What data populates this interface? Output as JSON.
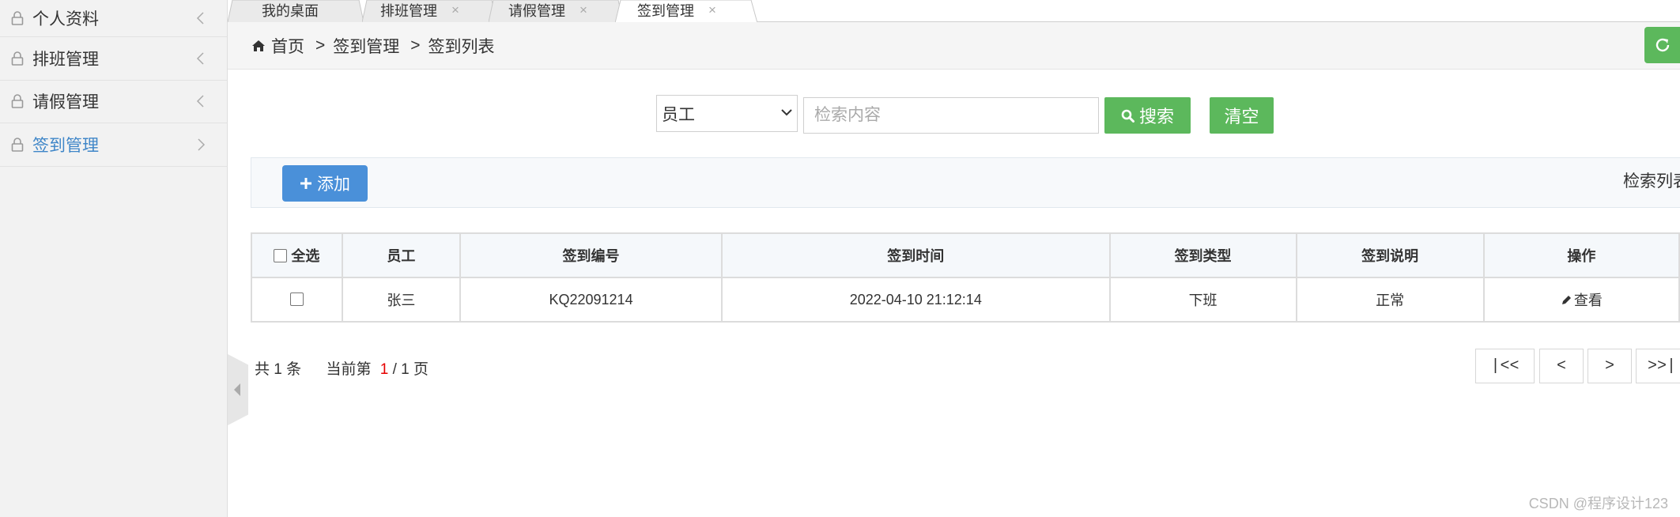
{
  "sidebar": {
    "items": [
      {
        "label": "个人资料",
        "active": false
      },
      {
        "label": "排班管理",
        "active": false
      },
      {
        "label": "请假管理",
        "active": false
      },
      {
        "label": "签到管理",
        "active": true
      }
    ]
  },
  "tabs": [
    {
      "label": "我的桌面",
      "closable": false,
      "active": false
    },
    {
      "label": "排班管理",
      "closable": true,
      "active": false
    },
    {
      "label": "请假管理",
      "closable": true,
      "active": false
    },
    {
      "label": "签到管理",
      "closable": true,
      "active": true
    }
  ],
  "tab_close_glyph": "×",
  "breadcrumb": {
    "home": "首页",
    "separator": ">",
    "level1": "签到管理",
    "level2": "签到列表"
  },
  "search": {
    "field_selected": "员工",
    "placeholder": "检索内容",
    "value": "",
    "search_label": "搜索",
    "clear_label": "清空"
  },
  "toolbar": {
    "add_label": "添加",
    "list_title": "检索列表"
  },
  "table": {
    "select_all_label": "全选",
    "headers": [
      "员工",
      "签到编号",
      "签到时间",
      "签到类型",
      "签到说明",
      "操作"
    ],
    "rows": [
      {
        "employee": "张三",
        "code": "KQ22091214",
        "time": "2022-04-10 21:12:14",
        "type": "下班",
        "note": "正常",
        "action": "查看"
      }
    ]
  },
  "pagination": {
    "total_prefix": "共",
    "total": "1",
    "total_suffix": "条",
    "current_prefix": "当前第",
    "current": "1",
    "slash": "/",
    "pages": "1",
    "pages_suffix": "页",
    "first_label": "|<<",
    "prev_label": "<",
    "next_label": ">",
    "last_label": ">>|"
  },
  "watermark": "CSDN @程序设计123",
  "colors": {
    "accent_green": "#5cb85c",
    "accent_blue": "#4a90d9",
    "active_link": "#3f86c8",
    "current_page": "#e60000"
  },
  "icons": [
    "lock-icon",
    "chevron-left-icon",
    "chevron-right-icon",
    "home-icon",
    "refresh-icon",
    "search-icon",
    "plus-icon",
    "pencil-icon",
    "dropdown-caret-icon",
    "collapse-arrow-icon"
  ]
}
